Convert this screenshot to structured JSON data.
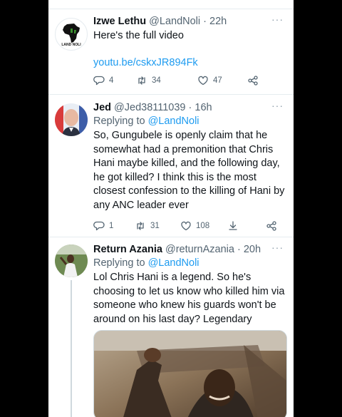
{
  "tweets": [
    {
      "name": "Izwe Lethu",
      "handle": "@LandNoli",
      "dot": "·",
      "time": "22h",
      "text": "Here's the full video",
      "link": "youtu.be/cskxJR894Fk",
      "avatar_text": "LAND NOLI",
      "replies": "4",
      "retweets": "34",
      "likes": "47"
    },
    {
      "name": "Jed",
      "handle": "@Jed38111039",
      "dot": "·",
      "time": "16h",
      "replying_prefix": "Replying to ",
      "replying_to": "@LandNoli",
      "text": "So, Gungubele is openly claim that he somewhat had a premonition that Chris Hani maybe killed, and the following day, he got killed? I think this is the most closest confession to the killing of Hani by any ANC leader ever",
      "replies": "1",
      "retweets": "31",
      "likes": "108"
    },
    {
      "name": "Return Azania",
      "handle": "@returnAzania",
      "dot": "·",
      "time": "20h",
      "replying_prefix": "Replying to ",
      "replying_to": "@LandNoli",
      "text": "Lol Chris Hani is a legend. So he's choosing to let us know who killed him via someone who knew his guards won't be around on his last day? Legendary"
    }
  ],
  "colors": {
    "link": "#1d9bf0",
    "text": "#0f1419",
    "secondary": "#536471"
  },
  "icons": [
    "reply-icon",
    "retweet-icon",
    "like-icon",
    "share-icon",
    "download-icon",
    "more-icon",
    "africa-logo-icon"
  ]
}
